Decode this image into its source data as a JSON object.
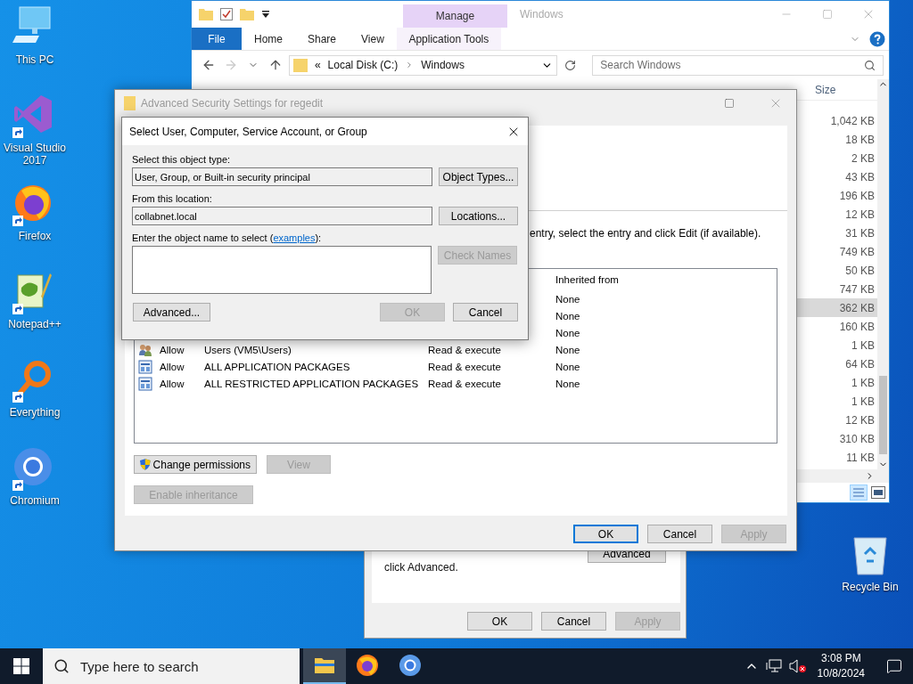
{
  "desktop": {
    "icons": [
      {
        "label": "This PC",
        "kind": "pc",
        "shortcut": false
      },
      {
        "label": "Visual Studio 2017",
        "kind": "vs",
        "shortcut": true
      },
      {
        "label": "Firefox",
        "kind": "firefox",
        "shortcut": true
      },
      {
        "label": "Notepad++",
        "kind": "notepad",
        "shortcut": true
      },
      {
        "label": "Everything",
        "kind": "everything",
        "shortcut": true
      },
      {
        "label": "Chromium",
        "kind": "chromium",
        "shortcut": true
      }
    ],
    "recycle_bin": {
      "label": "Recycle Bin"
    }
  },
  "explorer": {
    "title": "Windows",
    "context_group": "Manage",
    "ribbon_tabs": [
      {
        "label": "File",
        "kind": "file"
      },
      {
        "label": "Home",
        "kind": "tab"
      },
      {
        "label": "Share",
        "kind": "tab"
      },
      {
        "label": "View",
        "kind": "tab"
      },
      {
        "label": "Application Tools",
        "kind": "context"
      }
    ],
    "address": {
      "overflow": "«",
      "segments": [
        "Local Disk (C:)",
        "Windows"
      ]
    },
    "search": {
      "placeholder": "Search Windows"
    },
    "size_header": "Size",
    "rows": [
      {
        "size": "1,042 KB",
        "selected": false
      },
      {
        "size": "18 KB",
        "selected": false
      },
      {
        "size": "2 KB",
        "selected": false
      },
      {
        "size": "43 KB",
        "selected": false
      },
      {
        "size": "196 KB",
        "selected": false
      },
      {
        "size": "12 KB",
        "selected": false
      },
      {
        "size": "31 KB",
        "selected": false
      },
      {
        "size": "749 KB",
        "selected": false
      },
      {
        "size": "50 KB",
        "selected": false
      },
      {
        "size": "747 KB",
        "selected": false
      },
      {
        "size": "362 KB",
        "selected": true
      },
      {
        "size": "160 KB",
        "selected": false
      },
      {
        "size": "1 KB",
        "selected": false
      },
      {
        "size": "64 KB",
        "selected": false
      },
      {
        "size": "1 KB",
        "selected": false
      },
      {
        "size": "1 KB",
        "selected": false
      },
      {
        "size": "12 KB",
        "selected": false
      },
      {
        "size": "310 KB",
        "selected": false
      },
      {
        "size": "11 KB",
        "selected": false
      }
    ]
  },
  "properties": {
    "note": "click Advanced.",
    "advanced_button": "Advanced",
    "buttons": [
      {
        "label": "OK",
        "disabled": false
      },
      {
        "label": "Cancel",
        "disabled": false
      },
      {
        "label": "Apply",
        "disabled": true
      }
    ]
  },
  "advanced_security": {
    "title": "Advanced Security Settings for regedit",
    "hint": "entry, select the entry and click Edit (if available).",
    "list_header": "Inherited from",
    "rows": [
      {
        "kind": "covered",
        "inherited": "None"
      },
      {
        "kind": "covered",
        "inherited": "None"
      },
      {
        "kind": "covered",
        "inherited": "None"
      },
      {
        "kind": "users",
        "type": "Allow",
        "principal": "Users (VM5\\Users)",
        "access": "Read & execute",
        "inherited": "None"
      },
      {
        "kind": "package",
        "type": "Allow",
        "principal": "ALL APPLICATION PACKAGES",
        "access": "Read & execute",
        "inherited": "None"
      },
      {
        "kind": "package",
        "type": "Allow",
        "principal": "ALL RESTRICTED APPLICATION PACKAGES",
        "access": "Read & execute",
        "inherited": "None"
      }
    ],
    "actions": [
      {
        "label": "Change permissions",
        "kind": "shield",
        "disabled": false
      },
      {
        "label": "View",
        "kind": "plain",
        "disabled": true
      }
    ],
    "inheritance_button": {
      "label": "Enable inheritance",
      "disabled": true
    },
    "buttons": [
      {
        "label": "OK",
        "disabled": false,
        "focused": true
      },
      {
        "label": "Cancel",
        "disabled": false,
        "focused": false
      },
      {
        "label": "Apply",
        "disabled": true,
        "focused": false
      }
    ]
  },
  "select_dialog": {
    "title": "Select User, Computer, Service Account, or Group",
    "object_type": {
      "label": "Select this object type:",
      "value": "User, Group, or Built-in security principal",
      "button": "Object Types..."
    },
    "location": {
      "label": "From this location:",
      "value": "collabnet.local",
      "button": "Locations..."
    },
    "names": {
      "label_before": "Enter the object name to select (",
      "link": "examples",
      "label_after": "):",
      "button": {
        "label": "Check Names",
        "disabled": true
      }
    },
    "buttons": [
      {
        "label": "Advanced...",
        "disabled": false
      },
      {
        "label": "OK",
        "disabled": true
      },
      {
        "label": "Cancel",
        "disabled": false
      }
    ]
  },
  "taskbar": {
    "search": {
      "placeholder": "Type here to search"
    },
    "apps": [
      {
        "kind": "explorer",
        "active": true
      },
      {
        "kind": "firefox",
        "active": false
      },
      {
        "kind": "chromium",
        "active": false
      }
    ],
    "volume_muted": true,
    "clock": {
      "time": "3:08 PM",
      "date": "10/8/2024"
    }
  }
}
